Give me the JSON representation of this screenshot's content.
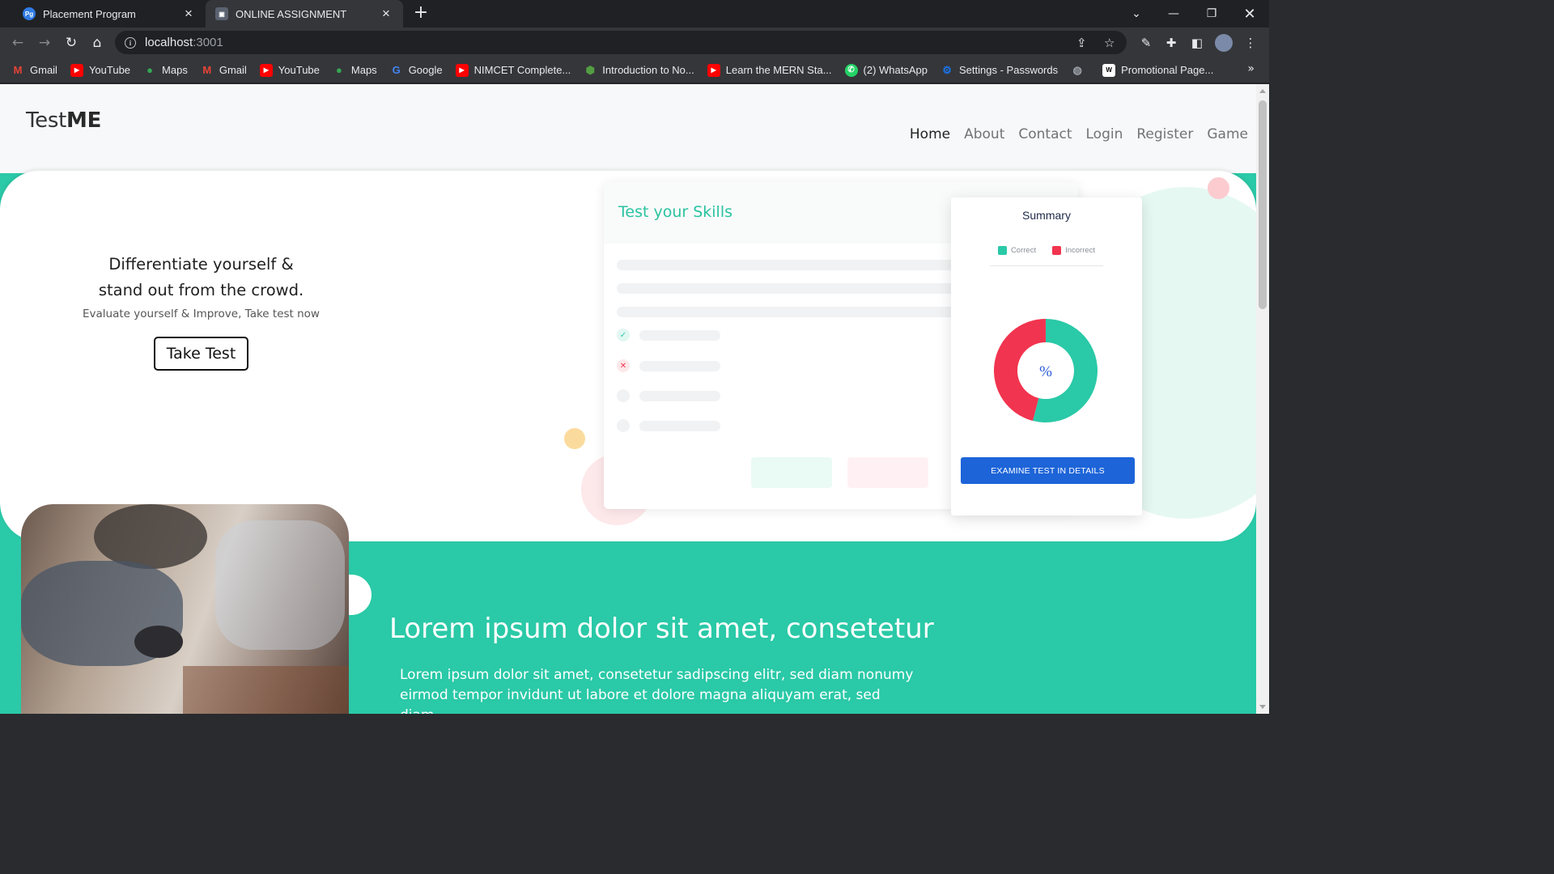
{
  "browser": {
    "tabs": [
      {
        "title": "Placement Program",
        "active": false
      },
      {
        "title": "ONLINE ASSIGNMENT",
        "active": true
      }
    ],
    "url_host": "localhost",
    "url_port": ":3001",
    "bookmarks": [
      {
        "label": "Gmail",
        "icon": "gmail-icon",
        "color": "#ea4335"
      },
      {
        "label": "YouTube",
        "icon": "youtube-icon",
        "color": "#ff0000"
      },
      {
        "label": "Maps",
        "icon": "maps-icon",
        "color": "#34a853"
      },
      {
        "label": "Gmail",
        "icon": "gmail-icon",
        "color": "#ea4335"
      },
      {
        "label": "YouTube",
        "icon": "youtube-icon",
        "color": "#ff0000"
      },
      {
        "label": "Maps",
        "icon": "maps-icon",
        "color": "#34a853"
      },
      {
        "label": "Google",
        "icon": "google-icon",
        "color": "#4285f4"
      },
      {
        "label": "NIMCET Complete...",
        "icon": "youtube-icon",
        "color": "#ff0000"
      },
      {
        "label": "Introduction to No...",
        "icon": "nodejs-icon",
        "color": "#539e43"
      },
      {
        "label": "Learn the MERN Sta...",
        "icon": "youtube-icon",
        "color": "#ff0000"
      },
      {
        "label": "(2) WhatsApp",
        "icon": "whatsapp-icon",
        "color": "#25d366"
      },
      {
        "label": "Settings - Passwords",
        "icon": "gear-icon",
        "color": "#1a73e8"
      },
      {
        "label": "",
        "icon": "globe-icon",
        "color": "#9aa0a6"
      },
      {
        "label": "Promotional Page...",
        "icon": "wix-icon",
        "color": "#ffffff"
      }
    ]
  },
  "site": {
    "logo_light": "Test",
    "logo_bold": "ME",
    "nav": [
      "Home",
      "About",
      "Contact",
      "Login",
      "Register",
      "Game"
    ],
    "active_nav": "Home"
  },
  "hero": {
    "title_line1": "Differentiate yourself &",
    "title_line2": "stand out from the crowd.",
    "subtitle": "Evaluate yourself & Improve, Take test now",
    "cta": "Take Test"
  },
  "test_card": {
    "title": "Test your Skills"
  },
  "summary": {
    "title": "Summary",
    "legend": [
      {
        "label": "Correct",
        "color": "#2ac9a7"
      },
      {
        "label": "Incorrect",
        "color": "#f1344f"
      }
    ],
    "center_label": "%",
    "correct_fraction": 0.54,
    "button": "EXAMINE TEST IN DETAILS"
  },
  "section": {
    "heading": "Lorem ipsum dolor sit amet, consetetur",
    "body": "Lorem ipsum dolor sit amet, consetetur sadipscing elitr, sed diam nonumy eirmod tempor invidunt ut labore et dolore magna aliquyam erat, sed diam"
  },
  "colors": {
    "accent": "#2ac9a7",
    "danger": "#f1344f",
    "primary_button": "#1d64d8"
  }
}
